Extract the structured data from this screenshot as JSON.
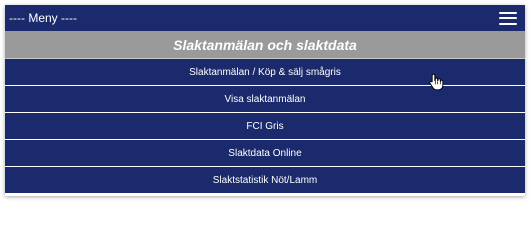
{
  "topbar": {
    "title": "---- Meny ----"
  },
  "section": {
    "title": "Slaktanmälan och slaktdata"
  },
  "menu": {
    "items": [
      {
        "label": "Slaktanmälan / Köp & sälj smågris"
      },
      {
        "label": "Visa slaktanmälan"
      },
      {
        "label": "FCI Gris"
      },
      {
        "label": "Slaktdata Online"
      },
      {
        "label": "Slaktstatistik Nöt/Lamm"
      }
    ]
  },
  "colors": {
    "navy": "#1a2a6c",
    "header_gray": "#9a9a9a",
    "text": "#ffffff"
  },
  "icons": {
    "menu": "hamburger-menu-icon",
    "cursor": "hand-pointer-cursor-icon"
  }
}
